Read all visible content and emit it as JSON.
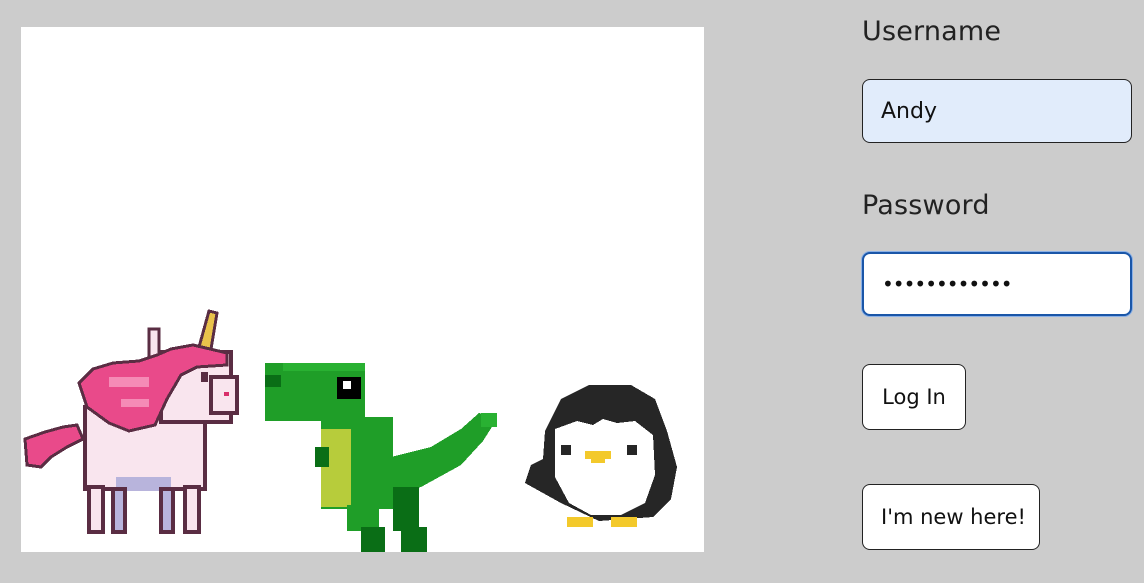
{
  "form": {
    "username_label": "Username",
    "username_value": "Andy",
    "password_label": "Password",
    "password_value": "secretpass12",
    "login_label": "Log In",
    "new_user_label": "I'm new here!"
  },
  "scene": {
    "characters": [
      "unicorn",
      "dinosaur",
      "penguin"
    ]
  },
  "colors": {
    "page_background": "#cccccc",
    "scene_background": "#ffffff",
    "username_field_background": "#e1ecfb",
    "focused_border": "#1a56a8"
  }
}
